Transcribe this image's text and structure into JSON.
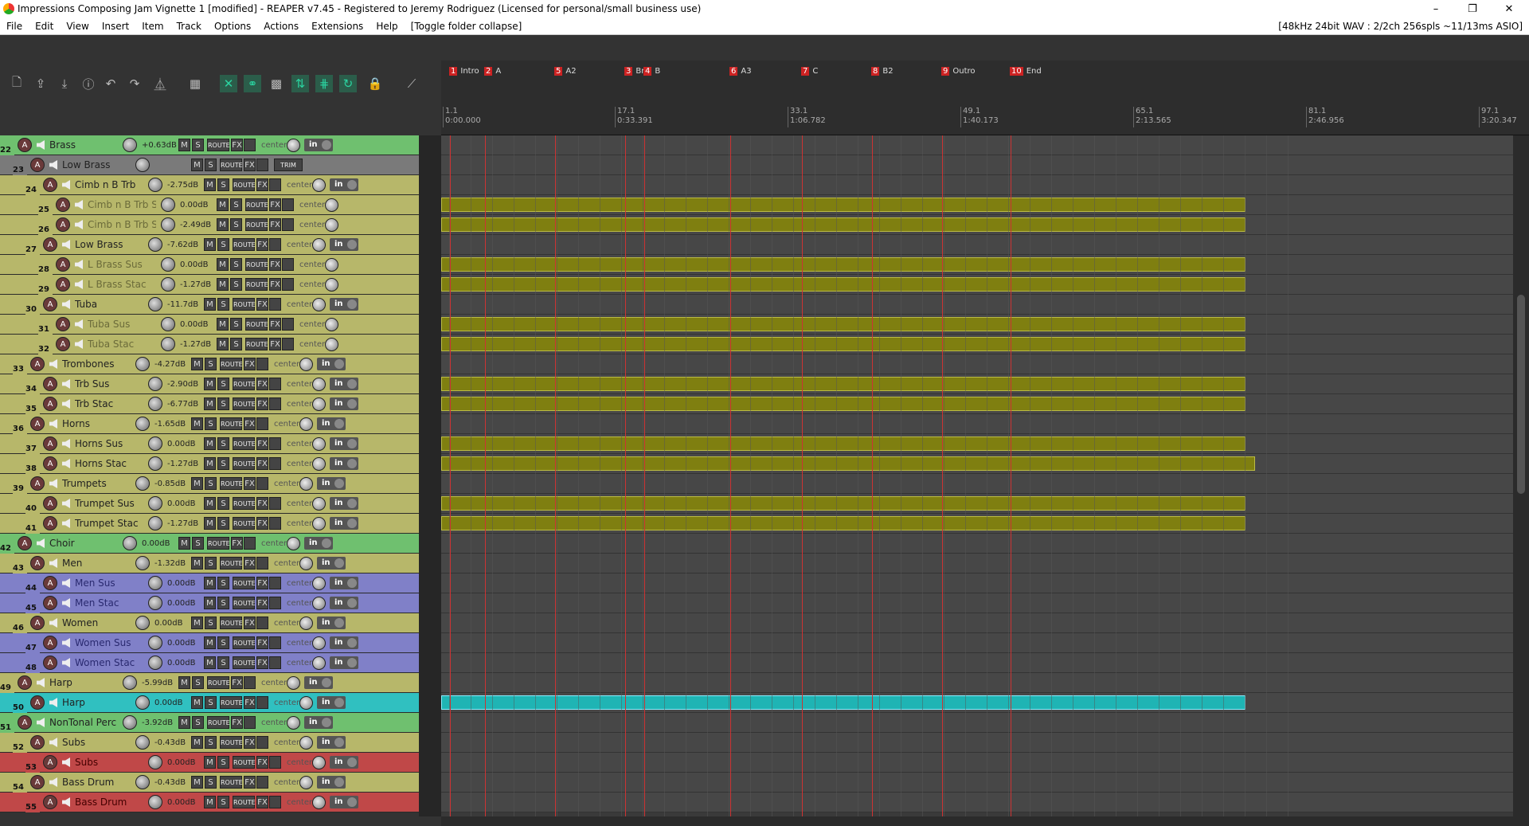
{
  "window": {
    "title": "Impressions Composing Jam Vignette 1 [modified] - REAPER v7.45 - Registered to Jeremy Rodriguez (Licensed for personal/small business use)",
    "minimize": "–",
    "maximize": "❐",
    "close": "✕"
  },
  "menu": {
    "items": [
      "File",
      "Edit",
      "View",
      "Insert",
      "Item",
      "Track",
      "Options",
      "Actions",
      "Extensions",
      "Help",
      "[Toggle folder collapse]"
    ],
    "status": "[48kHz 24bit WAV : 2/2ch 256spls ~11/13ms ASIO]"
  },
  "markers": [
    {
      "num": "1",
      "label": "Intro"
    },
    {
      "num": "2",
      "label": "A"
    },
    {
      "num": "5",
      "label": "A2"
    },
    {
      "num": "3",
      "label": "Br"
    },
    {
      "num": "4",
      "label": "B"
    },
    {
      "num": "6",
      "label": "A3"
    },
    {
      "num": "7",
      "label": "C"
    },
    {
      "num": "8",
      "label": "B2"
    },
    {
      "num": "9",
      "label": "Outro"
    },
    {
      "num": "10",
      "label": "End"
    }
  ],
  "ruler": [
    {
      "bar": "1.1",
      "time": "0:00.000"
    },
    {
      "bar": "17.1",
      "time": "0:33.391"
    },
    {
      "bar": "33.1",
      "time": "1:06.782"
    },
    {
      "bar": "49.1",
      "time": "1:40.173"
    },
    {
      "bar": "65.1",
      "time": "2:13.565"
    },
    {
      "bar": "81.1",
      "time": "2:46.956"
    },
    {
      "bar": "97.1",
      "time": "3:20.347"
    }
  ],
  "tracks": [
    {
      "num": "22",
      "name": "Brass",
      "db": "+0.63dB",
      "pan": "center",
      "in": "in"
    },
    {
      "num": "23",
      "name": "Low Brass",
      "db": "",
      "pan": "",
      "in": ""
    },
    {
      "num": "24",
      "name": "Cimb n B Trb",
      "db": "-2.75dB",
      "pan": "center",
      "in": "in"
    },
    {
      "num": "25",
      "name": "Cimb n B Trb S",
      "db": "0.00dB",
      "pan": "center",
      "in": ""
    },
    {
      "num": "26",
      "name": "Cimb n B Trb S",
      "db": "-2.49dB",
      "pan": "center",
      "in": ""
    },
    {
      "num": "27",
      "name": "Low Brass",
      "db": "-7.62dB",
      "pan": "center",
      "in": "in"
    },
    {
      "num": "28",
      "name": "L Brass Sus",
      "db": "0.00dB",
      "pan": "center",
      "in": ""
    },
    {
      "num": "29",
      "name": "L Brass Stac",
      "db": "-1.27dB",
      "pan": "center",
      "in": ""
    },
    {
      "num": "30",
      "name": "Tuba",
      "db": "-11.7dB",
      "pan": "center",
      "in": "in"
    },
    {
      "num": "31",
      "name": "Tuba Sus",
      "db": "0.00dB",
      "pan": "center",
      "in": ""
    },
    {
      "num": "32",
      "name": "Tuba Stac",
      "db": "-1.27dB",
      "pan": "center",
      "in": ""
    },
    {
      "num": "33",
      "name": "Trombones",
      "db": "-4.27dB",
      "pan": "center",
      "in": "in"
    },
    {
      "num": "34",
      "name": "Trb Sus",
      "db": "-2.90dB",
      "pan": "center",
      "in": "in"
    },
    {
      "num": "35",
      "name": "Trb Stac",
      "db": "-6.77dB",
      "pan": "center",
      "in": "in"
    },
    {
      "num": "36",
      "name": "Horns",
      "db": "-1.65dB",
      "pan": "center",
      "in": "in"
    },
    {
      "num": "37",
      "name": "Horns Sus",
      "db": "0.00dB",
      "pan": "center",
      "in": "in"
    },
    {
      "num": "38",
      "name": "Horns Stac",
      "db": "-1.27dB",
      "pan": "center",
      "in": "in"
    },
    {
      "num": "39",
      "name": "Trumpets",
      "db": "-0.85dB",
      "pan": "center",
      "in": "in"
    },
    {
      "num": "40",
      "name": "Trumpet Sus",
      "db": "0.00dB",
      "pan": "center",
      "in": "in"
    },
    {
      "num": "41",
      "name": "Trumpet Stac",
      "db": "-1.27dB",
      "pan": "center",
      "in": "in"
    },
    {
      "num": "42",
      "name": "Choir",
      "db": "0.00dB",
      "pan": "center",
      "in": "in"
    },
    {
      "num": "43",
      "name": "Men",
      "db": "-1.32dB",
      "pan": "center",
      "in": "in"
    },
    {
      "num": "44",
      "name": "Men Sus",
      "db": "0.00dB",
      "pan": "center",
      "in": "in"
    },
    {
      "num": "45",
      "name": "Men Stac",
      "db": "0.00dB",
      "pan": "center",
      "in": "in"
    },
    {
      "num": "46",
      "name": "Women",
      "db": "0.00dB",
      "pan": "center",
      "in": "in"
    },
    {
      "num": "47",
      "name": "Women Sus",
      "db": "0.00dB",
      "pan": "center",
      "in": "in"
    },
    {
      "num": "48",
      "name": "Women Stac",
      "db": "0.00dB",
      "pan": "center",
      "in": "in"
    },
    {
      "num": "49",
      "name": "Harp",
      "db": "-5.99dB",
      "pan": "center",
      "in": "in"
    },
    {
      "num": "50",
      "name": "Harp",
      "db": "0.00dB",
      "pan": "center",
      "in": "in"
    },
    {
      "num": "51",
      "name": "NonTonal Perc",
      "db": "-3.92dB",
      "pan": "center",
      "in": "in"
    },
    {
      "num": "52",
      "name": "Subs",
      "db": "-0.43dB",
      "pan": "center",
      "in": "in"
    },
    {
      "num": "53",
      "name": "Subs",
      "db": "0.00dB",
      "pan": "center",
      "in": "in"
    },
    {
      "num": "54",
      "name": "Bass Drum",
      "db": "-0.43dB",
      "pan": "center",
      "in": "in"
    },
    {
      "num": "55",
      "name": "Bass Drum",
      "db": "0.00dB",
      "pan": "center",
      "in": "in"
    }
  ],
  "labels": {
    "m": "M",
    "s": "S",
    "route": "ROUTE",
    "fx": "FX",
    "arm": "A",
    "trim": "TRIM"
  },
  "colors": {
    "olive": "#b7b76a",
    "green": "#6fc06f",
    "blue": "#8080c8",
    "cyan": "#30c0c0",
    "red": "#c04848",
    "item_olive": "#7f7f10",
    "item_cyan": "#1fb4b4"
  }
}
